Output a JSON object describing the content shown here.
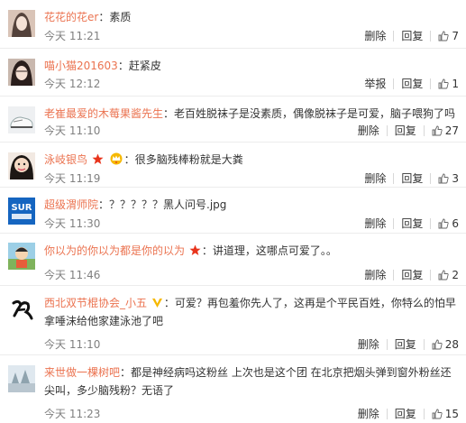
{
  "comments": [
    {
      "name": "花花的花er",
      "colon": "：",
      "text": "素质",
      "time": "今天 11:21",
      "actions": [
        "删除",
        "回复"
      ],
      "likes": "7"
    },
    {
      "name": "喵小猫201603",
      "colon": "：",
      "text": "赶紧皮",
      "time": "今天 12:12",
      "actions": [
        "举报",
        "回复"
      ],
      "likes": "1"
    },
    {
      "name": "老崔最爱的木莓果酱先生",
      "colon": "：",
      "text": "老百姓脱袜子是没素质，偶像脱袜子是可爱，脑子喂狗了吗",
      "time": "今天 11:10",
      "actions": [
        "删除",
        "回复"
      ],
      "likes": "27"
    },
    {
      "name": "泳岐银鸟",
      "colon": "：",
      "text": "很多脑残棒粉就是大粪",
      "time": "今天 11:19",
      "actions": [
        "删除",
        "回复"
      ],
      "likes": "3"
    },
    {
      "name": "超级渭师院",
      "colon": "：",
      "text": "？？？？？黑人问号.jpg",
      "time": "今天 11:30",
      "actions": [
        "删除",
        "回复"
      ],
      "likes": "6"
    },
    {
      "name": "你以为的你以为都是你的以为",
      "colon": "：",
      "text": "讲道理，这哪点可爱了。。",
      "time": "今天 11:46",
      "actions": [
        "删除",
        "回复"
      ],
      "likes": "2"
    },
    {
      "name": "西北双节棍协会_小五",
      "colon": "：",
      "text": "可爱？再包羞你先人了，这再是个平民百姓，你特么的怕早拿唾沫给他家建泳池了吧",
      "time": "今天 11:10",
      "actions": [
        "删除",
        "回复"
      ],
      "likes": "28"
    },
    {
      "name": "来世做一棵树吧",
      "colon": "：",
      "text": "都是神经病吗这粉丝 上次也是这个团 在北京把烟头弹到窗外粉丝还尖叫，多少脑残粉？无语了",
      "time": "今天 11:23",
      "actions": [
        "删除",
        "回复"
      ],
      "likes": "15"
    }
  ],
  "avatars": [
    "girl-avatar",
    "girl-avatar",
    "shoes-avatar",
    "cartoon-avatar",
    "logo-avatar",
    "cartoon-avatar",
    "calligraphy-avatar",
    "landscape-avatar"
  ],
  "avatar_logo_text": "SUR 超级渭师院",
  "avatar_calligraphy_text": "钢",
  "colors": {
    "name": "#eb7350",
    "time": "#808080",
    "text": "#333333",
    "star": "#e8341c",
    "crown": "#f6b800"
  }
}
